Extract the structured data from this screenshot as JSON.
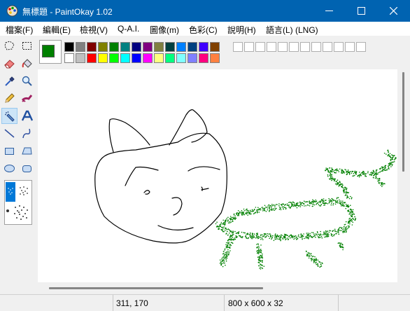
{
  "window": {
    "title": "無標題 - PaintOkay 1.02"
  },
  "menu": [
    "檔案(F)",
    "編輯(E)",
    "檢視(V)",
    "Q-A.I.",
    "圖像(m)",
    "色彩(C)",
    "說明(H)",
    "語言(L) (LNG)"
  ],
  "tools": [
    "free-select-icon",
    "rect-select-icon",
    "eraser-icon",
    "fill-bucket-icon",
    "color-picker-icon",
    "magnifier-icon",
    "pencil-icon",
    "brush-icon",
    "airbrush-icon",
    "text-icon",
    "line-icon",
    "curve-icon",
    "rectangle-icon",
    "polygon-icon",
    "ellipse-icon",
    "rounded-rect-icon"
  ],
  "selected_tool": "airbrush-icon",
  "colors": {
    "foreground": "#008000",
    "background": "#ffffff",
    "accent": "#0063b1",
    "palette_top": [
      "#000000",
      "#808080",
      "#800000",
      "#808000",
      "#008000",
      "#008080",
      "#000080",
      "#800080",
      "#808040",
      "#004040",
      "#0080ff",
      "#004080",
      "#4000ff",
      "#804000"
    ],
    "palette_bottom": [
      "#ffffff",
      "#c0c0c0",
      "#ff0000",
      "#ffff00",
      "#00ff00",
      "#00ffff",
      "#0000ff",
      "#ff00ff",
      "#ffff80",
      "#00ff80",
      "#80ffff",
      "#8080ff",
      "#ff0080",
      "#ff8040"
    ],
    "custom_slots": 12
  },
  "status": {
    "cursor_pos": "311, 170",
    "image_info": "800 x 600 x 32"
  }
}
